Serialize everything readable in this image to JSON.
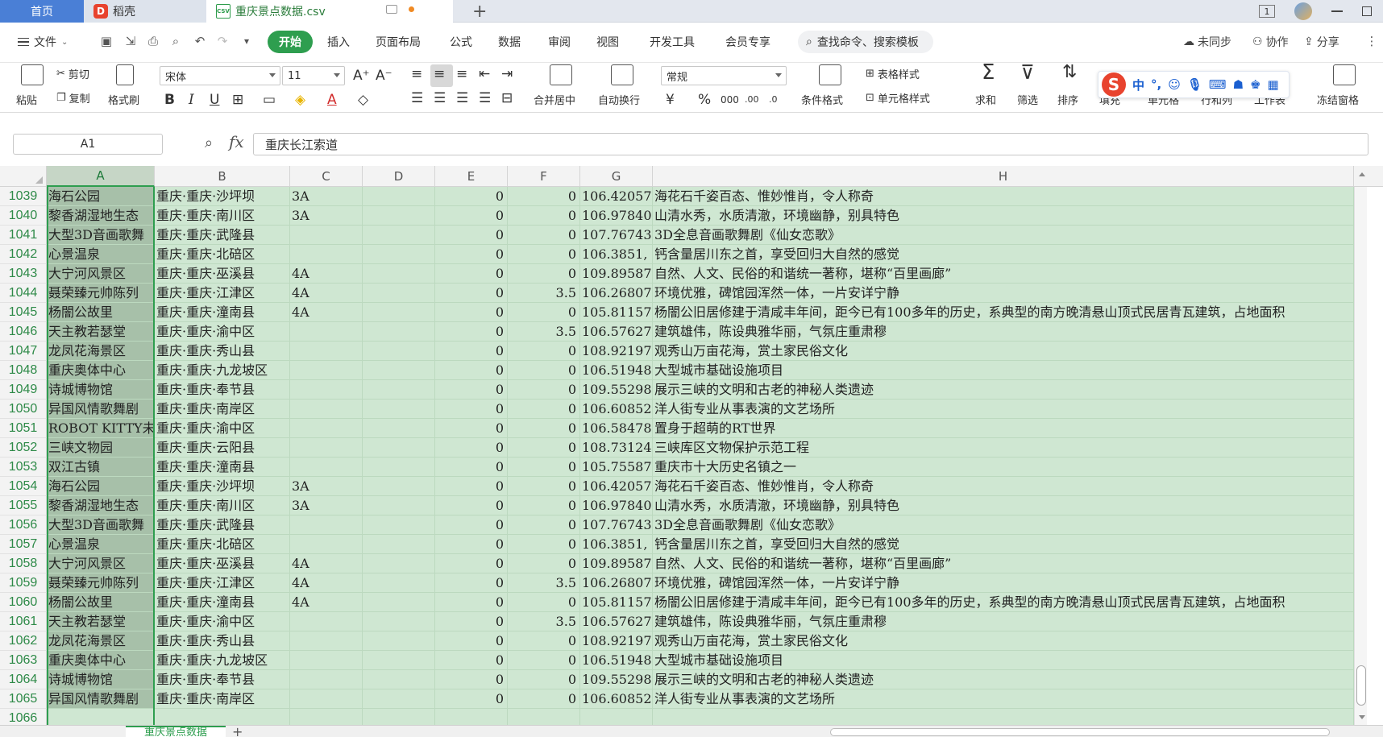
{
  "tabs": {
    "home": "首页",
    "daoke": "稻壳",
    "file": "重庆景点数据.csv",
    "csv_badge": "CSV",
    "daoke_badge": "D"
  },
  "window": {
    "badge_count": "1"
  },
  "menu": {
    "file": "文件",
    "start": "开始",
    "insert": "插入",
    "page_layout": "页面布局",
    "formula": "公式",
    "data": "数据",
    "review": "审阅",
    "view": "视图",
    "dev_tools": "开发工具",
    "member": "会员专享",
    "search_placeholder": "查找命令、搜索模板",
    "sync": "未同步",
    "collab": "协作",
    "share": "分享"
  },
  "ribbon": {
    "paste": "粘贴",
    "cut": "剪切",
    "copy": "复制",
    "format_painter": "格式刷",
    "font_name": "宋体",
    "font_size": "11",
    "merge_center": "合并居中",
    "wrap_text": "自动换行",
    "number_format": "常规",
    "conditional_format": "条件格式",
    "table_style": "表格样式",
    "cell_style": "单元格样式",
    "sum": "求和",
    "filter": "筛选",
    "sort": "排序",
    "fill": "填充",
    "cell": "单元格",
    "row_col": "行和列",
    "worksheet": "工作表",
    "freeze": "冻结窗格"
  },
  "ime": {
    "mode": "中",
    "punct": "°,"
  },
  "formula_bar": {
    "cell_ref": "A1",
    "content": "重庆长江索道"
  },
  "columns": [
    "A",
    "B",
    "C",
    "D",
    "E",
    "F",
    "G",
    "H"
  ],
  "rows": [
    {
      "n": "1039",
      "a": "海石公园",
      "b": "重庆·重庆·沙坪坝",
      "c": "3A",
      "e": "0",
      "f": "0",
      "g": "106.42057",
      "h": "海花石千姿百态、惟妙惟肖，令人称奇"
    },
    {
      "n": "1040",
      "a": "黎香湖湿地生态",
      "b": "重庆·重庆·南川区",
      "c": "3A",
      "e": "0",
      "f": "0",
      "g": "106.978409",
      "h": "山清水秀，水质清澈，环境幽静，别具特色"
    },
    {
      "n": "1041",
      "a": "大型3D音画歌舞",
      "b": "重庆·重庆·武隆县",
      "c": "",
      "e": "0",
      "f": "0",
      "g": "107.767437",
      "h": "3D全息音画歌舞剧《仙女恋歌》"
    },
    {
      "n": "1042",
      "a": "心景温泉",
      "b": "重庆·重庆·北碚区",
      "c": "",
      "e": "0",
      "f": "0",
      "g": "106.3851,",
      "h": "钙含量居川东之首，享受回归大自然的感觉"
    },
    {
      "n": "1043",
      "a": "大宁河风景区",
      "b": "重庆·重庆·巫溪县",
      "c": "4A",
      "e": "0",
      "f": "0",
      "g": "109.89587,",
      "h": "自然、人文、民俗的和谐统一著称，堪称“百里画廊”"
    },
    {
      "n": "1044",
      "a": "聂荣臻元帅陈列",
      "b": "重庆·重庆·江津区",
      "c": "4A",
      "e": "0",
      "f": "3.5",
      "g": "106.268076",
      "h": "环境优雅，碑馆园浑然一体，一片安详宁静"
    },
    {
      "n": "1045",
      "a": "杨闇公故里",
      "b": "重庆·重庆·潼南县",
      "c": "4A",
      "e": "0",
      "f": "0",
      "g": "105.811573",
      "h": "杨闇公旧居修建于清咸丰年间，距今已有100多年的历史，系典型的南方晚清悬山顶式民居青瓦建筑，占地面积"
    },
    {
      "n": "1046",
      "a": "天主教若瑟堂",
      "b": "重庆·重庆·渝中区",
      "c": "",
      "e": "0",
      "f": "3.5",
      "g": "106.576277",
      "h": "建筑雄伟，陈设典雅华丽，气氛庄重肃穆"
    },
    {
      "n": "1047",
      "a": "龙凤花海景区",
      "b": "重庆·重庆·秀山县",
      "c": "",
      "e": "0",
      "f": "0",
      "g": "108.92197,",
      "h": "观秀山万亩花海，赏土家民俗文化"
    },
    {
      "n": "1048",
      "a": "重庆奥体中心",
      "b": "重庆·重庆·九龙坡区",
      "c": "",
      "e": "0",
      "f": "0",
      "g": "106.51948",
      "h": "大型城市基础设施项目"
    },
    {
      "n": "1049",
      "a": "诗城博物馆",
      "b": "重庆·重庆·奉节县",
      "c": "",
      "e": "0",
      "f": "0",
      "g": "109.55298,",
      "h": "展示三峡的文明和古老的神秘人类遗迹"
    },
    {
      "n": "1050",
      "a": "异国风情歌舞剧",
      "b": "重庆·重庆·南岸区",
      "c": "",
      "e": "0",
      "f": "0",
      "g": "106.608523",
      "h": "洋人街专业从事表演的文艺场所"
    },
    {
      "n": "1051",
      "a": "ROBOT KITTY未来",
      "b": "重庆·重庆·渝中区",
      "c": "",
      "e": "0",
      "f": "0",
      "g": "106.584784",
      "h": "置身于超萌的RT世界"
    },
    {
      "n": "1052",
      "a": "三峡文物园",
      "b": "重庆·重庆·云阳县",
      "c": "",
      "e": "0",
      "f": "0",
      "g": "108.731243",
      "h": "三峡库区文物保护示范工程"
    },
    {
      "n": "1053",
      "a": "双江古镇",
      "b": "重庆·重庆·潼南县",
      "c": "",
      "e": "0",
      "f": "0",
      "g": "105.755875",
      "h": "重庆市十大历史名镇之一"
    },
    {
      "n": "1054",
      "a": "海石公园",
      "b": "重庆·重庆·沙坪坝",
      "c": "3A",
      "e": "0",
      "f": "0",
      "g": "106.42057",
      "h": "海花石千姿百态、惟妙惟肖，令人称奇"
    },
    {
      "n": "1055",
      "a": "黎香湖湿地生态",
      "b": "重庆·重庆·南川区",
      "c": "3A",
      "e": "0",
      "f": "0",
      "g": "106.978409",
      "h": "山清水秀，水质清澈，环境幽静，别具特色"
    },
    {
      "n": "1056",
      "a": "大型3D音画歌舞",
      "b": "重庆·重庆·武隆县",
      "c": "",
      "e": "0",
      "f": "0",
      "g": "107.767437",
      "h": "3D全息音画歌舞剧《仙女恋歌》"
    },
    {
      "n": "1057",
      "a": "心景温泉",
      "b": "重庆·重庆·北碚区",
      "c": "",
      "e": "0",
      "f": "0",
      "g": "106.3851,",
      "h": "钙含量居川东之首，享受回归大自然的感觉"
    },
    {
      "n": "1058",
      "a": "大宁河风景区",
      "b": "重庆·重庆·巫溪县",
      "c": "4A",
      "e": "0",
      "f": "0",
      "g": "109.89587,",
      "h": "自然、人文、民俗的和谐统一著称，堪称“百里画廊”"
    },
    {
      "n": "1059",
      "a": "聂荣臻元帅陈列",
      "b": "重庆·重庆·江津区",
      "c": "4A",
      "e": "0",
      "f": "3.5",
      "g": "106.268076",
      "h": "环境优雅，碑馆园浑然一体，一片安详宁静"
    },
    {
      "n": "1060",
      "a": "杨闇公故里",
      "b": "重庆·重庆·潼南县",
      "c": "4A",
      "e": "0",
      "f": "0",
      "g": "105.811573",
      "h": "杨闇公旧居修建于清咸丰年间，距今已有100多年的历史，系典型的南方晚清悬山顶式民居青瓦建筑，占地面积"
    },
    {
      "n": "1061",
      "a": "天主教若瑟堂",
      "b": "重庆·重庆·渝中区",
      "c": "",
      "e": "0",
      "f": "3.5",
      "g": "106.576277",
      "h": "建筑雄伟，陈设典雅华丽，气氛庄重肃穆"
    },
    {
      "n": "1062",
      "a": "龙凤花海景区",
      "b": "重庆·重庆·秀山县",
      "c": "",
      "e": "0",
      "f": "0",
      "g": "108.92197,",
      "h": "观秀山万亩花海，赏土家民俗文化"
    },
    {
      "n": "1063",
      "a": "重庆奥体中心",
      "b": "重庆·重庆·九龙坡区",
      "c": "",
      "e": "0",
      "f": "0",
      "g": "106.51948",
      "h": "大型城市基础设施项目"
    },
    {
      "n": "1064",
      "a": "诗城博物馆",
      "b": "重庆·重庆·奉节县",
      "c": "",
      "e": "0",
      "f": "0",
      "g": "109.55298,",
      "h": "展示三峡的文明和古老的神秘人类遗迹"
    },
    {
      "n": "1065",
      "a": "异国风情歌舞剧",
      "b": "重庆·重庆·南岸区",
      "c": "",
      "e": "0",
      "f": "0",
      "g": "106.608523",
      "h": "洋人街专业从事表演的文艺场所"
    },
    {
      "n": "1066",
      "a": "",
      "b": "",
      "c": "",
      "e": "",
      "f": "",
      "g": "",
      "h": ""
    }
  ],
  "sheet": {
    "name": "重庆景点数据"
  },
  "colors": {
    "accent_green": "#2e9e4f",
    "selection_fill": "#cfe7d2",
    "column_a_fill": "#a7c0a9",
    "home_tab_blue": "#4a7fd6"
  }
}
